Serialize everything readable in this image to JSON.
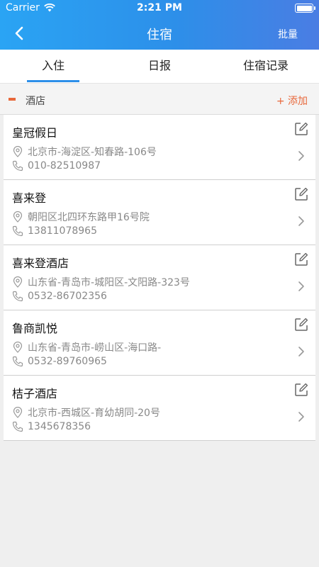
{
  "status_bar": {
    "carrier": "Carrier",
    "time": "2:21 PM"
  },
  "nav": {
    "title": "住宿",
    "batch_label": "批量"
  },
  "tabs": [
    {
      "label": "入住",
      "active": true
    },
    {
      "label": "日报",
      "active": false
    },
    {
      "label": "住宿记录",
      "active": false
    }
  ],
  "section": {
    "title": "酒店",
    "add_label": "+ 添加"
  },
  "hotels": [
    {
      "name": "皇冠假日",
      "address": "北京市-海淀区-知春路-106号",
      "phone": "010-82510987"
    },
    {
      "name": "喜来登",
      "address": "朝阳区北四环东路甲16号院",
      "phone": "13811078965"
    },
    {
      "name": "喜来登酒店",
      "address": "山东省-青岛市-城阳区-文阳路-323号",
      "phone": "0532-86702356"
    },
    {
      "name": "鲁商凯悦",
      "address": "山东省-青岛市-崂山区-海口路-",
      "phone": "0532-89760965"
    },
    {
      "name": "桔子酒店",
      "address": "北京市-西城区-育幼胡同-20号",
      "phone": "1345678356"
    }
  ],
  "colors": {
    "header": "#2d8fe9",
    "accent": "#e8683b",
    "tab_indicator": "#2d8fe9"
  },
  "icons": {
    "back": "chevron-left-icon",
    "edit": "edit-icon",
    "location": "location-pin-icon",
    "phone": "phone-icon",
    "chevron": "chevron-right-icon",
    "wifi": "wifi-icon",
    "battery": "battery-icon"
  }
}
